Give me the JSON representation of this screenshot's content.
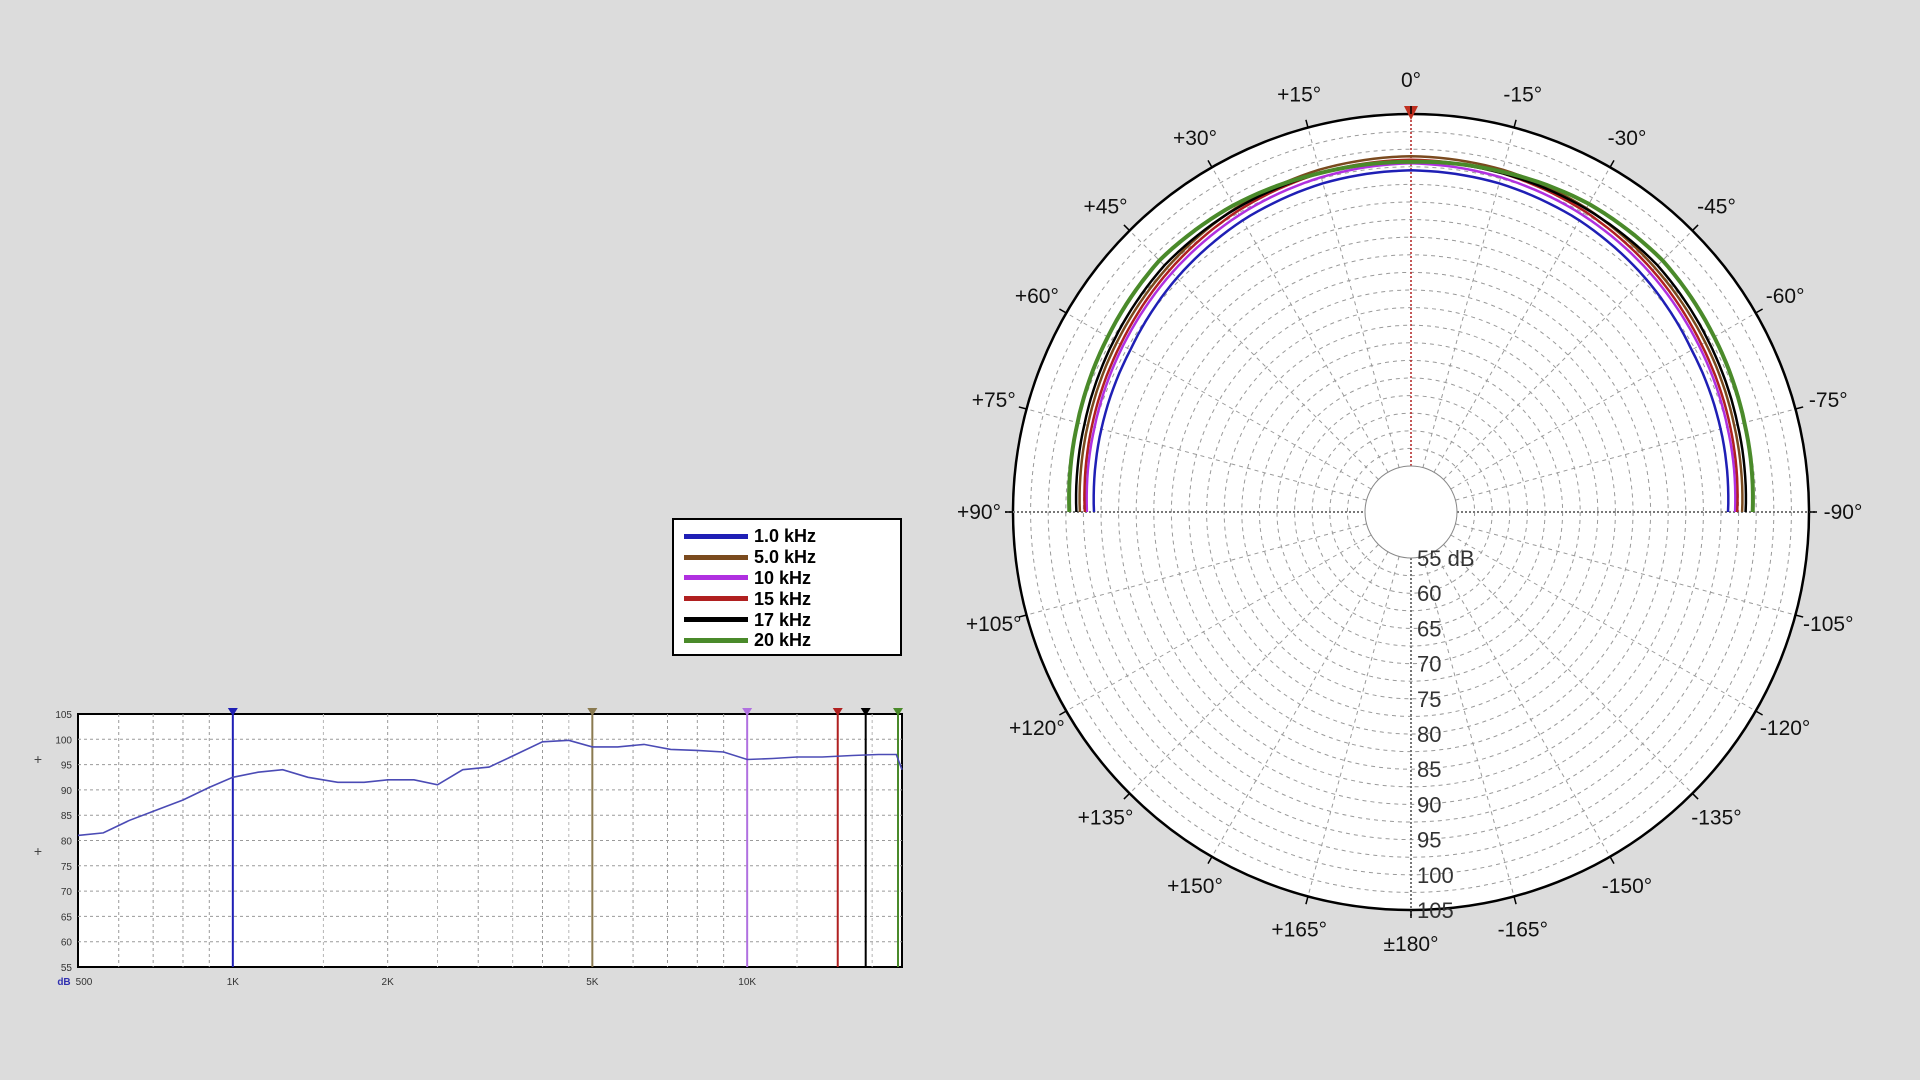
{
  "chart_data": [
    {
      "type": "line",
      "subtype": "polar",
      "angle_labels": [
        "0°",
        "-15°",
        "-30°",
        "-45°",
        "-60°",
        "-75°",
        "-90°",
        "-105°",
        "-120°",
        "-135°",
        "-150°",
        "-165°",
        "±180°",
        "+165°",
        "+150°",
        "+135°",
        "+120°",
        "+105°",
        "+90°",
        "+75°",
        "+60°",
        "+45°",
        "+30°",
        "+15°"
      ],
      "radial_labels": [
        "55 dB",
        "60",
        "65",
        "70",
        "75",
        "80",
        "85",
        "90",
        "95",
        "100",
        "105"
      ],
      "radial_range": [
        55,
        105
      ],
      "angle_range": [
        -90,
        90
      ],
      "grid": true,
      "legend_position": "left",
      "series": [
        {
          "name": "1.0 kHz",
          "color": "#1f1fb5",
          "width": 2.5,
          "angles": [
            -90,
            -75,
            -60,
            -45,
            -30,
            -15,
            0,
            15,
            30,
            45,
            60,
            75,
            90
          ],
          "values": [
            93.5,
            94.0,
            94.5,
            95.5,
            96.3,
            96.8,
            97.0,
            96.8,
            96.3,
            95.5,
            94.5,
            94.0,
            93.5
          ]
        },
        {
          "name": "5.0 kHz",
          "color": "#7a4a1e",
          "width": 2.5,
          "angles": [
            -90,
            -75,
            -60,
            -45,
            -30,
            -15,
            0,
            15,
            30,
            45,
            60,
            75,
            90
          ],
          "values": [
            95.5,
            96.0,
            96.7,
            97.5,
            98.3,
            98.8,
            99.0,
            98.8,
            98.3,
            97.5,
            96.7,
            96.0,
            95.5
          ]
        },
        {
          "name": "10 kHz",
          "color": "#b030e0",
          "width": 2.5,
          "angles": [
            -90,
            -75,
            -60,
            -45,
            -30,
            -15,
            0,
            15,
            30,
            45,
            60,
            75,
            90
          ],
          "values": [
            94.5,
            95.0,
            95.7,
            96.5,
            97.2,
            97.7,
            98.0,
            97.7,
            97.2,
            96.5,
            95.7,
            95.0,
            94.5
          ]
        },
        {
          "name": "15 kHz",
          "color": "#b02020",
          "width": 2.5,
          "angles": [
            -90,
            -75,
            -60,
            -45,
            -30,
            -15,
            0,
            15,
            30,
            45,
            60,
            75,
            90
          ],
          "values": [
            94.8,
            95.4,
            96.1,
            97.0,
            97.8,
            98.3,
            98.5,
            98.3,
            97.8,
            97.0,
            96.1,
            95.4,
            94.8
          ]
        },
        {
          "name": "17 kHz",
          "color": "#000000",
          "width": 2.5,
          "angles": [
            -90,
            -75,
            -60,
            -45,
            -30,
            -15,
            0,
            15,
            30,
            45,
            60,
            75,
            90
          ],
          "values": [
            96.0,
            96.5,
            97.2,
            98.0,
            98.2,
            98.3,
            98.3,
            98.3,
            98.2,
            98.0,
            97.2,
            96.5,
            96.0
          ]
        },
        {
          "name": "20 kHz",
          "color": "#4a8a2a",
          "width": 4,
          "angles": [
            -90,
            -75,
            -60,
            -45,
            -30,
            -15,
            0,
            15,
            30,
            45,
            60,
            75,
            90
          ],
          "values": [
            97.0,
            97.5,
            98.2,
            99.0,
            99.0,
            98.5,
            98.2,
            98.3,
            98.8,
            99.0,
            98.2,
            97.5,
            97.0
          ]
        }
      ]
    },
    {
      "type": "line",
      "xscale": "log",
      "xlim": [
        500,
        20000
      ],
      "x_tick_labels": [
        {
          "value": 500,
          "label": "500"
        },
        {
          "value": 1000,
          "label": "1K"
        },
        {
          "value": 2000,
          "label": "2K"
        },
        {
          "value": 5000,
          "label": "5K"
        },
        {
          "value": 10000,
          "label": "10K"
        }
      ],
      "ylim": [
        55,
        105
      ],
      "y_tick_labels": [
        "105",
        "100",
        "95",
        "90",
        "85",
        "80",
        "75",
        "70",
        "65",
        "60",
        "55"
      ],
      "y_unit_label": "dB",
      "grid": true,
      "series": [
        {
          "color": "#4b4bb5",
          "x": [
            500,
            560,
            630,
            710,
            800,
            900,
            1000,
            1120,
            1250,
            1400,
            1600,
            1800,
            2000,
            2250,
            2500,
            2800,
            3150,
            3550,
            4000,
            4500,
            5000,
            5600,
            6300,
            7100,
            8000,
            9000,
            10000,
            11200,
            12500,
            14000,
            16000,
            18000,
            19500,
            20000
          ],
          "values": [
            81,
            81.5,
            84,
            86,
            88,
            90.5,
            92.5,
            93.5,
            94,
            92.5,
            91.5,
            91.5,
            92,
            92,
            91,
            94,
            94.5,
            97,
            99.5,
            99.8,
            98.5,
            98.5,
            99,
            98,
            97.8,
            97.5,
            96,
            96.2,
            96.5,
            96.5,
            96.8,
            97,
            97,
            94
          ]
        }
      ],
      "markers": [
        {
          "x": 1000,
          "color": "#1f1fb5"
        },
        {
          "x": 5000,
          "color": "#8a7a50"
        },
        {
          "x": 10000,
          "color": "#b070e0"
        },
        {
          "x": 15000,
          "color": "#b02020"
        },
        {
          "x": 17000,
          "color": "#000000"
        },
        {
          "x": 20000,
          "color": "#4a8a2a"
        }
      ],
      "side_marks": [
        "+",
        "+"
      ]
    }
  ]
}
